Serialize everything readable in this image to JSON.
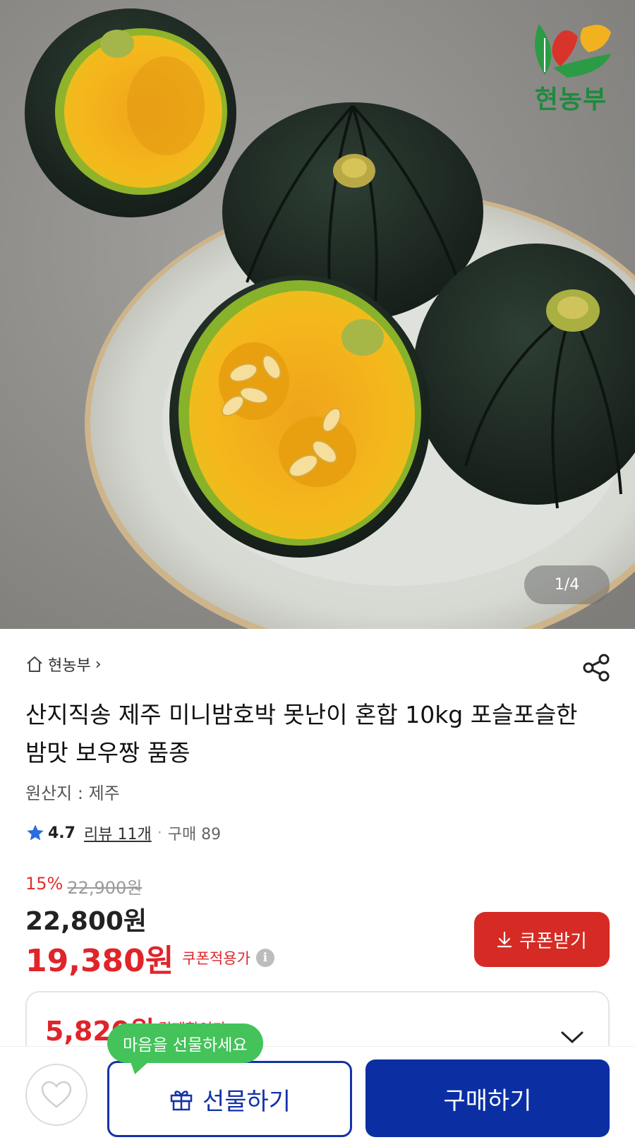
{
  "hero": {
    "brand_name": "현농부",
    "image_counter": "1/4"
  },
  "store": {
    "name": "현농부",
    "chevron": "›",
    "icon": "home-icon"
  },
  "product": {
    "title": "산지직송 제주 미니밤호박 못난이 혼합 10kg 포슬포슬한 밤맛 보우짱 품종",
    "origin": "원산지 : 제주",
    "rating": "4.7",
    "reviews": "리뷰 11개",
    "separator": "·",
    "purchases": "구매 89"
  },
  "pricing": {
    "discount": "15%",
    "original_price": "22,900원",
    "sale_price": "22,800원",
    "coupon_price": "19,380원",
    "coupon_label": "쿠폰적용가",
    "info_icon": "i",
    "coupon_button": "쿠폰받기",
    "payment_price": "5,820원",
    "payment_label": "결제할인가"
  },
  "bottom_bar": {
    "tooltip": "마음을 선물하세요",
    "gift_button": "선물하기",
    "buy_button": "구매하기"
  },
  "colors": {
    "accent_red": "#d52b24",
    "price_red": "#e0242a",
    "primary_blue": "#0b2fa3",
    "tooltip_green": "#43c35a",
    "brand_green": "#1f8a3e"
  }
}
